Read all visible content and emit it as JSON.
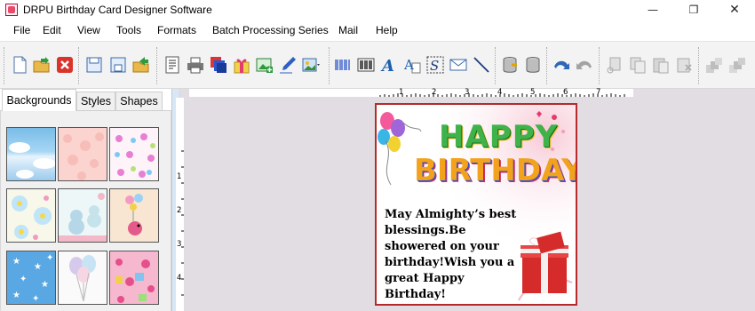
{
  "window": {
    "title": "DRPU Birthday Card Designer Software",
    "controls": [
      "minimize",
      "restore",
      "close"
    ]
  },
  "menu": [
    "File",
    "Edit",
    "View",
    "Tools",
    "Formats",
    "Batch Processing Series",
    "Mail",
    "Help"
  ],
  "toolbar": {
    "icons": [
      "new-icon",
      "open-icon",
      "close-icon",
      "save-icon",
      "save-as-icon",
      "export-icon",
      "properties-icon",
      "print-icon",
      "print-multiple-icon",
      "gift-icon",
      "add-image-icon",
      "signature-pen-icon",
      "image-library-icon",
      "barcode-icon",
      "barcode-2-icon",
      "wordart-icon",
      "text-icon",
      "shape-s-icon",
      "mail-icon",
      "line-icon",
      "database-import-icon",
      "database-icon",
      "undo-icon",
      "redo-icon",
      "cut-icon",
      "copy-icon",
      "paste-icon",
      "delete-icon",
      "bring-front-icon",
      "send-back-icon"
    ]
  },
  "panel": {
    "tabs": [
      "Backgrounds",
      "Styles",
      "Shapes"
    ],
    "active_tab": "Backgrounds",
    "thumbnails": [
      "clouds",
      "pink-hearts",
      "butterflies",
      "flowers",
      "teddy-bears",
      "balloon-bird",
      "stars",
      "balloons",
      "hearts-gifts"
    ]
  },
  "ruler": {
    "h_marks": [
      "1",
      "2",
      "3",
      "4",
      "5",
      "6",
      "7"
    ],
    "v_marks": [
      "1",
      "2",
      "3",
      "4"
    ]
  },
  "card": {
    "headline_line1": "HAPPY",
    "headline_line2": "BIRTHDAY",
    "message": "May Almighty’s best blessings.Be showered on your birthday!Wish you a great Happy Birthday!"
  },
  "colors": {
    "card_border": "#b52a2a",
    "canvas_bg": "#e2dde2",
    "splitter": "#d9e7f4"
  }
}
